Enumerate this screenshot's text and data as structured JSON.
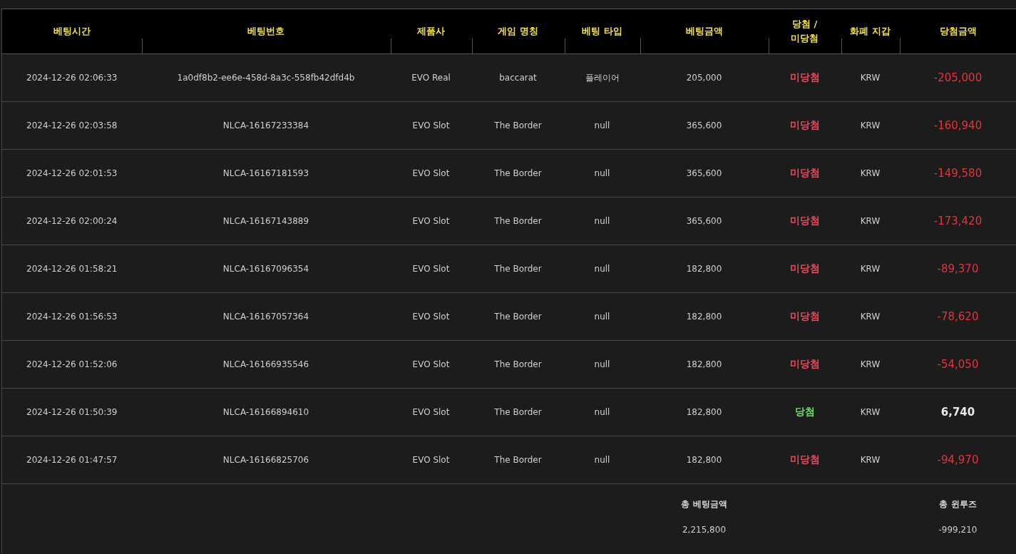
{
  "table": {
    "columns": [
      "베팅시간",
      "베팅번호",
      "제품사",
      "게임 명칭",
      "베팅 타입",
      "베팅금액",
      "당첨 /\n미당첨",
      "화폐 지갑",
      "당첨금액"
    ],
    "rows": [
      {
        "time": "2024-12-26 02:06:33",
        "bet_id": "1a0df8b2-ee6e-458d-8a3c-558fb42dfd4b",
        "provider": "EVO Real",
        "game": "baccarat",
        "bet_type": "플레이어",
        "amount": "205,000",
        "result": "미당첨",
        "won": false,
        "currency": "KRW",
        "win_amount": "-205,000"
      },
      {
        "time": "2024-12-26 02:03:58",
        "bet_id": "NLCA-16167233384",
        "provider": "EVO Slot",
        "game": "The Border",
        "bet_type": "null",
        "amount": "365,600",
        "result": "미당첨",
        "won": false,
        "currency": "KRW",
        "win_amount": "-160,940"
      },
      {
        "time": "2024-12-26 02:01:53",
        "bet_id": "NLCA-16167181593",
        "provider": "EVO Slot",
        "game": "The Border",
        "bet_type": "null",
        "amount": "365,600",
        "result": "미당첨",
        "won": false,
        "currency": "KRW",
        "win_amount": "-149,580"
      },
      {
        "time": "2024-12-26 02:00:24",
        "bet_id": "NLCA-16167143889",
        "provider": "EVO Slot",
        "game": "The Border",
        "bet_type": "null",
        "amount": "365,600",
        "result": "미당첨",
        "won": false,
        "currency": "KRW",
        "win_amount": "-173,420"
      },
      {
        "time": "2024-12-26 01:58:21",
        "bet_id": "NLCA-16167096354",
        "provider": "EVO Slot",
        "game": "The Border",
        "bet_type": "null",
        "amount": "182,800",
        "result": "미당첨",
        "won": false,
        "currency": "KRW",
        "win_amount": "-89,370"
      },
      {
        "time": "2024-12-26 01:56:53",
        "bet_id": "NLCA-16167057364",
        "provider": "EVO Slot",
        "game": "The Border",
        "bet_type": "null",
        "amount": "182,800",
        "result": "미당첨",
        "won": false,
        "currency": "KRW",
        "win_amount": "-78,620"
      },
      {
        "time": "2024-12-26 01:52:06",
        "bet_id": "NLCA-16166935546",
        "provider": "EVO Slot",
        "game": "The Border",
        "bet_type": "null",
        "amount": "182,800",
        "result": "미당첨",
        "won": false,
        "currency": "KRW",
        "win_amount": "-54,050"
      },
      {
        "time": "2024-12-26 01:50:39",
        "bet_id": "NLCA-16166894610",
        "provider": "EVO Slot",
        "game": "The Border",
        "bet_type": "null",
        "amount": "182,800",
        "result": "당첨",
        "won": true,
        "currency": "KRW",
        "win_amount": "6,740"
      },
      {
        "time": "2024-12-26 01:47:57",
        "bet_id": "NLCA-16166825706",
        "provider": "EVO Slot",
        "game": "The Border",
        "bet_type": "null",
        "amount": "182,800",
        "result": "미당첨",
        "won": false,
        "currency": "KRW",
        "win_amount": "-94,970"
      }
    ]
  },
  "totals": {
    "bet_label": "총 베팅금액",
    "bet_value": "2,215,800",
    "winloss_label": "총 윈루즈",
    "winloss_value": "-999,210"
  }
}
